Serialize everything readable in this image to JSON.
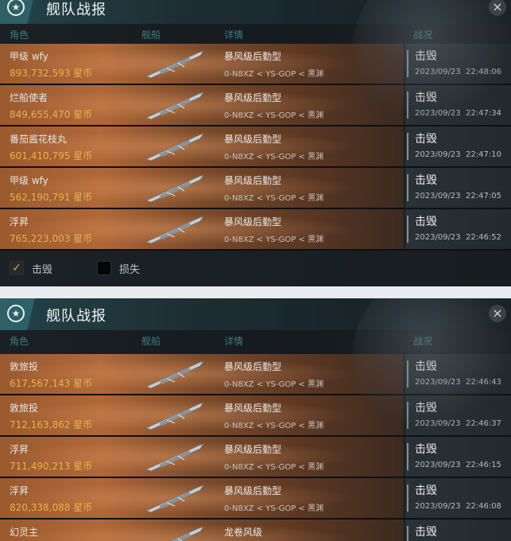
{
  "window": {
    "title": "舰队战报",
    "close_label": "×"
  },
  "columns": {
    "role": "角色",
    "ship": "舰船",
    "detail": "详情",
    "status": "战况"
  },
  "panel_top": {
    "rows": [
      {
        "name": "甲级 wfy",
        "value": "893,732,593 星币",
        "ship_type": "暴风级后勤型",
        "location": "0-N8XZ < YS-GOP < 黑渊",
        "status": "击毁",
        "date": "2023/09/23",
        "time": "22:48:06"
      },
      {
        "name": "烂船使者",
        "value": "849,655,470 星币",
        "ship_type": "暴风级后勤型",
        "location": "0-N8XZ < YS-GOP < 黑渊",
        "status": "击毁",
        "date": "2023/09/23",
        "time": "22:47:34"
      },
      {
        "name": "番茄酱花枝丸",
        "value": "601,410,795 星币",
        "ship_type": "暴风级后勤型",
        "location": "0-N8XZ < YS-GOP < 黑渊",
        "status": "击毁",
        "date": "2023/09/23",
        "time": "22:47:10"
      },
      {
        "name": "甲级 wfy",
        "value": "562,190,791 星币",
        "ship_type": "暴风级后勤型",
        "location": "0-N8XZ < YS-GOP < 黑渊",
        "status": "击毁",
        "date": "2023/09/23",
        "time": "22:47:05"
      },
      {
        "name": "浮昇",
        "value": "765,223,003 星币",
        "ship_type": "暴风级后勤型",
        "location": "0-N8XZ < YS-GOP < 黑渊",
        "status": "击毁",
        "date": "2023/09/23",
        "time": "22:46:52"
      }
    ],
    "filters": {
      "kill_label": "击毁",
      "kill_checked": "✓",
      "loss_label": "损失"
    }
  },
  "panel_bottom": {
    "rows": [
      {
        "name": "敦旅投",
        "value": "617,567,143 星币",
        "ship_type": "暴风级后勤型",
        "location": "0-N8XZ < YS-GOP < 黑渊",
        "status": "击毁",
        "date": "2023/09/23",
        "time": "22:46:43"
      },
      {
        "name": "敦旅投",
        "value": "712,163,862 星币",
        "ship_type": "暴风级后勤型",
        "location": "0-N8XZ < YS-GOP < 黑渊",
        "status": "击毁",
        "date": "2023/09/23",
        "time": "22:46:37"
      },
      {
        "name": "浮昇",
        "value": "711,490,213 星币",
        "ship_type": "暴风级后勤型",
        "location": "0-N8XZ < YS-GOP < 黑渊",
        "status": "击毁",
        "date": "2023/09/23",
        "time": "22:46:15"
      },
      {
        "name": "浮昇",
        "value": "820,338,088 星币",
        "ship_type": "暴风级后勤型",
        "location": "0-N8XZ < YS-GOP < 黑渊",
        "status": "击毁",
        "date": "2023/09/23",
        "time": "22:46:08"
      },
      {
        "name": "幻灵主",
        "value": "",
        "ship_type": "龙卷风级",
        "location": "",
        "status": "击毁",
        "date": "",
        "time": ""
      }
    ]
  },
  "icons": {
    "badge": "rank-star-icon",
    "ship": "battleship-icon",
    "close": "close-icon"
  }
}
